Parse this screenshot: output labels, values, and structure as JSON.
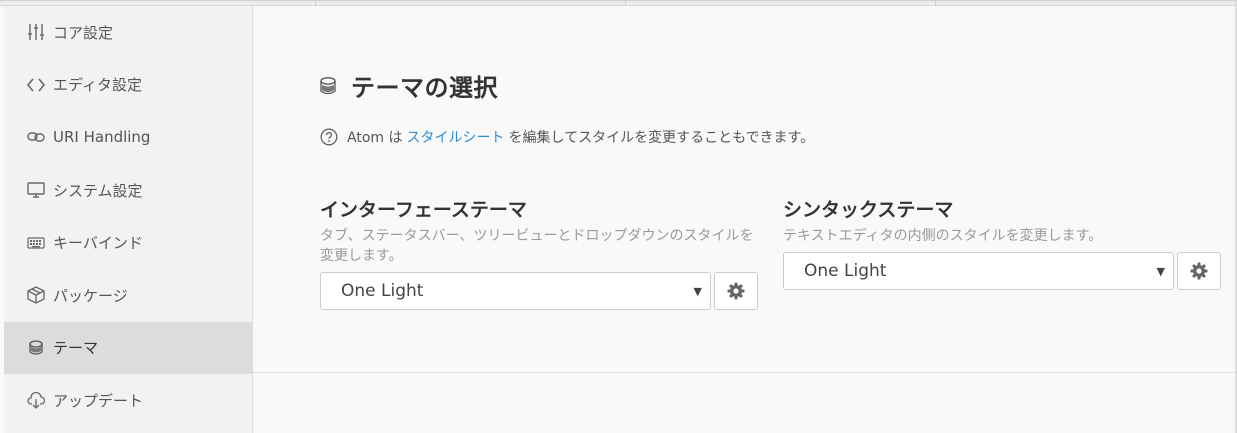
{
  "sidebar": {
    "items": [
      {
        "label": "コア設定",
        "icon": "sliders-icon"
      },
      {
        "label": "エディタ設定",
        "icon": "code-icon"
      },
      {
        "label": "URI Handling",
        "icon": "link-icon"
      },
      {
        "label": "システム設定",
        "icon": "monitor-icon"
      },
      {
        "label": "キーバインド",
        "icon": "keyboard-icon"
      },
      {
        "label": "パッケージ",
        "icon": "package-icon"
      },
      {
        "label": "テーマ",
        "icon": "paintcan-icon"
      },
      {
        "label": "アップデート",
        "icon": "cloud-download-icon"
      }
    ],
    "active_index": 6
  },
  "main": {
    "title": "テーマの選択",
    "note": {
      "prefix": "Atom は",
      "link": "スタイルシート",
      "suffix": "を編集してスタイルを変更することもできます。"
    },
    "ui_theme": {
      "heading": "インターフェーステーマ",
      "description": "タブ、ステータスバー、ツリービューとドロップダウンのスタイルを変更します。",
      "selected": "One Light"
    },
    "syntax_theme": {
      "heading": "シンタックステーマ",
      "description": "テキストエディタの内側のスタイルを変更します。",
      "selected": "One Light"
    }
  },
  "colors": {
    "link": "#2e8fd8",
    "sidebar_active": "#dcdcdc",
    "background": "#f9f9f9"
  }
}
